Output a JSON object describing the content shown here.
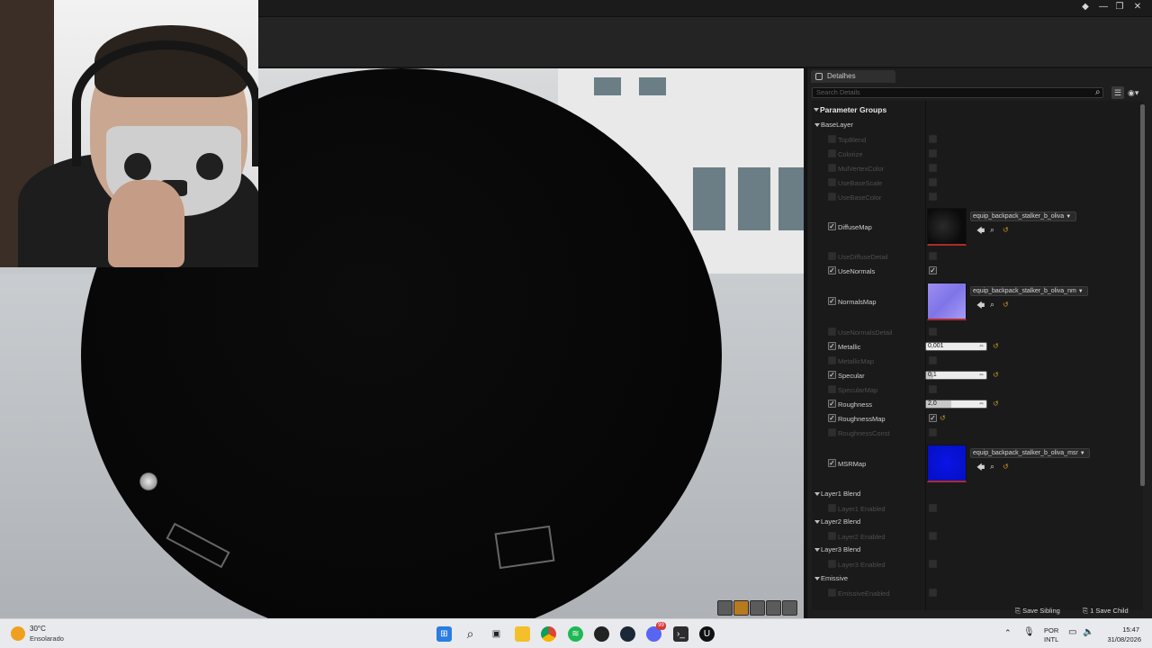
{
  "window": {
    "min_label": "—",
    "max_label": "❐",
    "close_label": "✕"
  },
  "details": {
    "tab_label": "Detalhes",
    "search_placeholder": "Search Details",
    "group_header": "Parameter Groups",
    "sections": {
      "base_layer": "BaseLayer",
      "layer1": "Layer1 Blend",
      "layer2": "Layer2 Blend",
      "layer3": "Layer3 Blend",
      "emissive": "Emissive"
    },
    "params": {
      "top_blend": "TopBlend",
      "colorize": "Colorize",
      "mul_vertex_color": "MulVertexColor",
      "use_base_scale": "UseBaseScale",
      "use_base_color": "UseBaseColor",
      "diffuse_map": "DiffuseMap",
      "diffuse_map_asset": "equip_backpack_stalker_b_oliva",
      "use_diffuse_detail": "UseDiffuseDetail",
      "use_normals": "UseNormals",
      "normals_map": "NormalsMap",
      "normals_map_asset": "equip_backpack_stalker_b_oliva_nm",
      "use_normals_detail": "UseNormalsDetail",
      "metallic": "Metallic",
      "metallic_value": "0,001",
      "metallic_map": "MetallicMap",
      "specular": "Specular",
      "specular_value": "0,1",
      "specular_map": "SpecularMap",
      "roughness": "Roughness",
      "roughness_value": "2,0",
      "roughness_map": "RoughnessMap",
      "roughness_const": "RoughnessConst",
      "msr_map": "MSRMap",
      "msr_map_asset": "equip_backpack_stalker_b_oliva_msr",
      "layer1_enabled": "Layer1 Enabled",
      "layer2_enabled": "Layer2 Enabled",
      "layer3_enabled": "Layer3 Enabled",
      "emissive_enabled": "EmissiveEnabled"
    },
    "footer": {
      "save_sibling": "Save Sibling",
      "save_child": "1 Save Child"
    }
  },
  "taskbar": {
    "weather_temp": "30°C",
    "weather_desc": "Ensolarado",
    "lang_top": "POR",
    "lang_bottom": "INTL",
    "time": "15:47",
    "date": "31/08/2026",
    "chat_badge": "99"
  },
  "colors": {
    "accent_orange": "#c99a2a",
    "panel_bg": "#1e1e1e",
    "taskbar_bg": "#e9eaed"
  }
}
